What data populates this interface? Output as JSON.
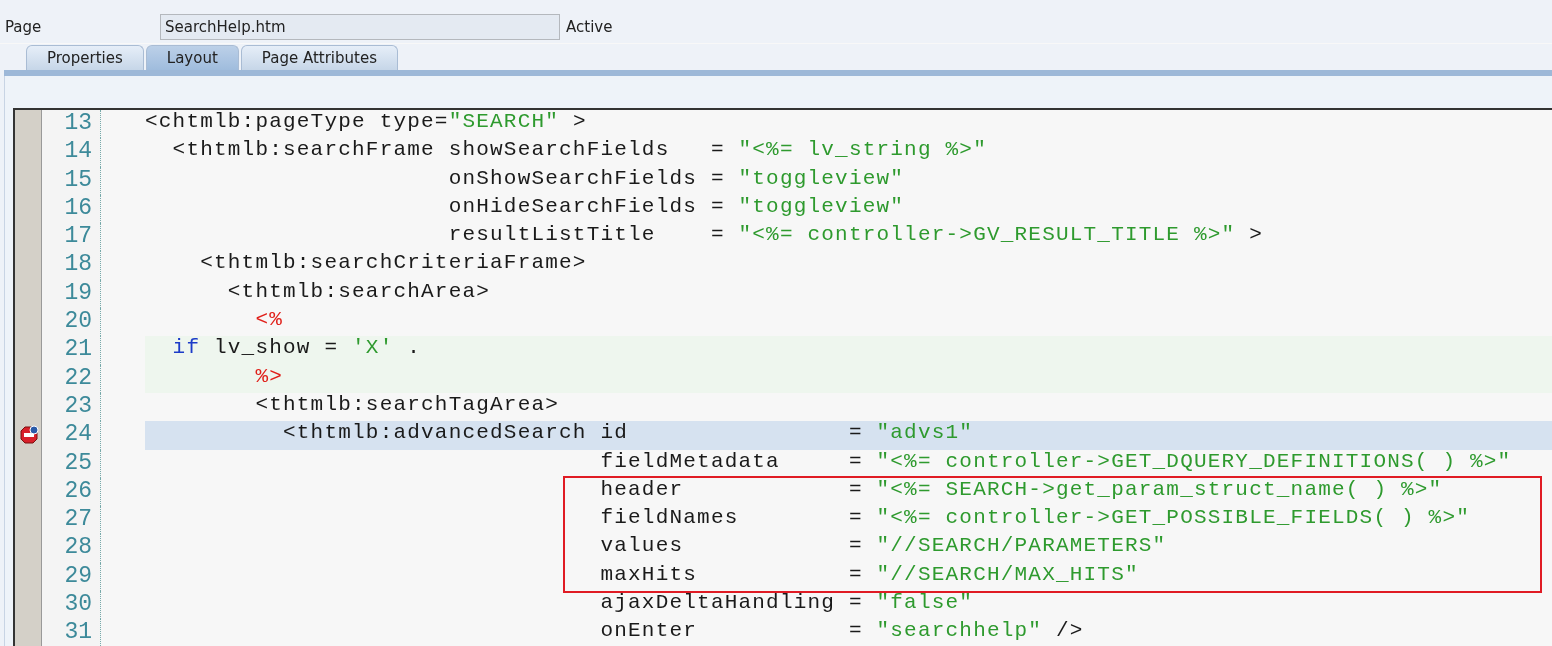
{
  "header": {
    "label": "Page",
    "field_value": "SearchHelp.htm",
    "status": "Active"
  },
  "tabs": [
    {
      "label": "Properties",
      "selected": false
    },
    {
      "label": "Layout",
      "selected": true
    },
    {
      "label": "Page Attributes",
      "selected": false
    }
  ],
  "editor": {
    "lines": [
      {
        "number": "13",
        "kind": "markup",
        "current": false,
        "breakpoint": false,
        "boxed": false,
        "segments": [
          {
            "kind": "plain",
            "text": "<chtmlb:pageType type="
          },
          {
            "kind": "string",
            "text": "\"SEARCH\""
          },
          {
            "kind": "plain",
            "text": " >"
          }
        ]
      },
      {
        "number": "14",
        "kind": "markup",
        "current": false,
        "breakpoint": false,
        "boxed": false,
        "segments": [
          {
            "kind": "plain",
            "text": "  <thtmlb:searchFrame showSearchFields   = "
          },
          {
            "kind": "string",
            "text": "\"<%= lv_string %>\""
          }
        ]
      },
      {
        "number": "15",
        "kind": "markup",
        "current": false,
        "breakpoint": false,
        "boxed": false,
        "segments": [
          {
            "kind": "plain",
            "text": "                      onShowSearchFields = "
          },
          {
            "kind": "string",
            "text": "\"toggleview\""
          }
        ]
      },
      {
        "number": "16",
        "kind": "markup",
        "current": false,
        "breakpoint": false,
        "boxed": false,
        "segments": [
          {
            "kind": "plain",
            "text": "                      onHideSearchFields = "
          },
          {
            "kind": "string",
            "text": "\"toggleview\""
          }
        ]
      },
      {
        "number": "17",
        "kind": "markup",
        "current": false,
        "breakpoint": false,
        "boxed": false,
        "segments": [
          {
            "kind": "plain",
            "text": "                      resultListTitle    = "
          },
          {
            "kind": "string",
            "text": "\"<%= controller->GV_RESULT_TITLE %>\""
          },
          {
            "kind": "plain",
            "text": " >"
          }
        ]
      },
      {
        "number": "18",
        "kind": "markup",
        "current": false,
        "breakpoint": false,
        "boxed": false,
        "segments": [
          {
            "kind": "plain",
            "text": "    <thtmlb:searchCriteriaFrame>"
          }
        ]
      },
      {
        "number": "19",
        "kind": "markup",
        "current": false,
        "breakpoint": false,
        "boxed": false,
        "segments": [
          {
            "kind": "plain",
            "text": "      <thtmlb:searchArea>"
          }
        ]
      },
      {
        "number": "20",
        "kind": "markup",
        "current": false,
        "breakpoint": false,
        "boxed": false,
        "segments": [
          {
            "kind": "delimiter",
            "text": "        <%"
          }
        ]
      },
      {
        "number": "21",
        "kind": "abap",
        "current": false,
        "breakpoint": false,
        "boxed": false,
        "segments": [
          {
            "kind": "keyword",
            "text": "  if"
          },
          {
            "kind": "plain",
            "text": " lv_show = "
          },
          {
            "kind": "string",
            "text": "'X'"
          },
          {
            "kind": "plain",
            "text": " ."
          }
        ]
      },
      {
        "number": "22",
        "kind": "abap",
        "current": false,
        "breakpoint": false,
        "boxed": false,
        "segments": [
          {
            "kind": "delimiter",
            "text": "        %>"
          }
        ]
      },
      {
        "number": "23",
        "kind": "markup",
        "current": false,
        "breakpoint": false,
        "boxed": false,
        "segments": [
          {
            "kind": "plain",
            "text": "        <thtmlb:searchTagArea>"
          }
        ]
      },
      {
        "number": "24",
        "kind": "markup",
        "current": true,
        "breakpoint": true,
        "boxed": false,
        "segments": [
          {
            "kind": "plain",
            "text": "          <thtmlb:advancedSearch id                = "
          },
          {
            "kind": "string",
            "text": "\"advs1\""
          }
        ]
      },
      {
        "number": "25",
        "kind": "markup",
        "current": false,
        "breakpoint": false,
        "boxed": false,
        "segments": [
          {
            "kind": "plain",
            "text": "                                 fieldMetadata     = "
          },
          {
            "kind": "string",
            "text": "\"<%= controller->GET_DQUERY_DEFINITIONS( ) %>\""
          }
        ]
      },
      {
        "number": "26",
        "kind": "markup",
        "current": false,
        "breakpoint": false,
        "boxed": true,
        "segments": [
          {
            "kind": "plain",
            "text": "                                 header            = "
          },
          {
            "kind": "string",
            "text": "\"<%= SEARCH->get_param_struct_name( ) %>\""
          }
        ]
      },
      {
        "number": "27",
        "kind": "markup",
        "current": false,
        "breakpoint": false,
        "boxed": true,
        "segments": [
          {
            "kind": "plain",
            "text": "                                 fieldNames        = "
          },
          {
            "kind": "string",
            "text": "\"<%= controller->GET_POSSIBLE_FIELDS( ) %>\""
          }
        ]
      },
      {
        "number": "28",
        "kind": "markup",
        "current": false,
        "breakpoint": false,
        "boxed": true,
        "segments": [
          {
            "kind": "plain",
            "text": "                                 values            = "
          },
          {
            "kind": "string",
            "text": "\"//SEARCH/PARAMETERS\""
          }
        ]
      },
      {
        "number": "29",
        "kind": "markup",
        "current": false,
        "breakpoint": false,
        "boxed": true,
        "segments": [
          {
            "kind": "plain",
            "text": "                                 maxHits           = "
          },
          {
            "kind": "string",
            "text": "\"//SEARCH/MAX_HITS\""
          }
        ]
      },
      {
        "number": "30",
        "kind": "markup",
        "current": false,
        "breakpoint": false,
        "boxed": false,
        "segments": [
          {
            "kind": "plain",
            "text": "                                 ajaxDeltaHandling = "
          },
          {
            "kind": "string",
            "text": "\"false\""
          }
        ]
      },
      {
        "number": "31",
        "kind": "markup",
        "current": false,
        "breakpoint": false,
        "boxed": false,
        "segments": [
          {
            "kind": "plain",
            "text": "                                 onEnter           = "
          },
          {
            "kind": "string",
            "text": "\"searchhelp\""
          },
          {
            "kind": "plain",
            "text": " />"
          }
        ]
      }
    ]
  }
}
